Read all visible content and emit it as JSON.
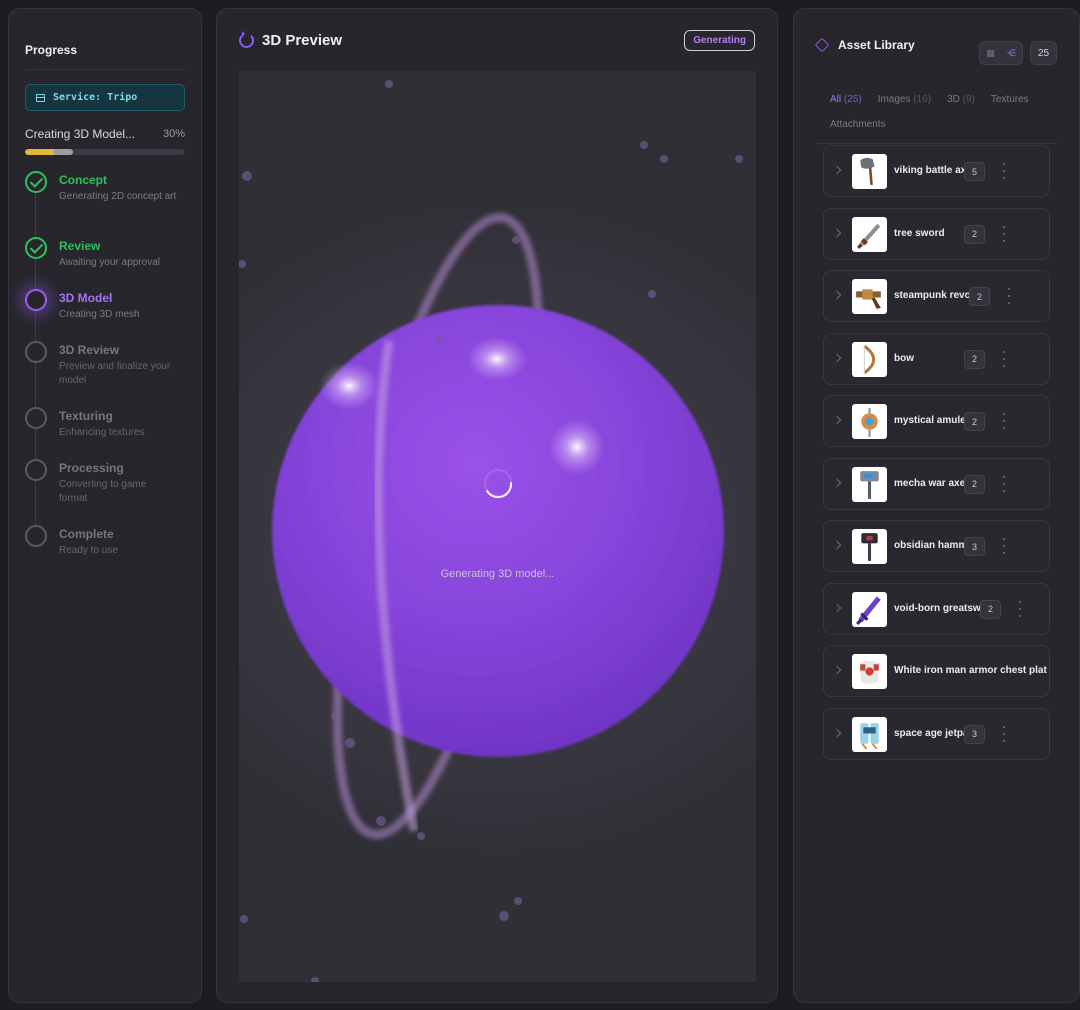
{
  "progress": {
    "title": "Progress",
    "service_label": "Service: Tripo",
    "status_text": "Creating 3D Model...",
    "percent_label": "30%",
    "percent_value": 30,
    "steps": [
      {
        "label": "Concept",
        "desc": "Generating 2D concept art",
        "state": "done"
      },
      {
        "label": "Review",
        "desc": "Awaiting your approval",
        "state": "done"
      },
      {
        "label": "3D Model",
        "desc": "Creating 3D mesh",
        "state": "active"
      },
      {
        "label": "3D Review",
        "desc": "Preview and finalize your model",
        "state": "pending"
      },
      {
        "label": "Texturing",
        "desc": "Enhancing textures",
        "state": "pending"
      },
      {
        "label": "Processing",
        "desc": "Converting to game format",
        "state": "pending"
      },
      {
        "label": "Complete",
        "desc": "Ready to use",
        "state": "pending"
      }
    ]
  },
  "preview": {
    "title": "3D Preview",
    "badge": "Generating",
    "loading_text": "Generating 3D model..."
  },
  "library": {
    "title": "Asset Library",
    "count": "25",
    "tabs": [
      {
        "label": "All",
        "count": "(25)",
        "active": true
      },
      {
        "label": "Images",
        "count": "(16)",
        "active": false
      },
      {
        "label": "3D",
        "count": "(9)",
        "active": false
      },
      {
        "label": "Textures",
        "count": "",
        "active": false
      },
      {
        "label": "Attachments",
        "count": "",
        "active": false
      }
    ],
    "items": [
      {
        "name": "viking battle axe",
        "count": "5",
        "icon": "axe-icon"
      },
      {
        "name": "tree sword",
        "count": "2",
        "icon": "sword-icon"
      },
      {
        "name": "steampunk revolver",
        "count": "2",
        "icon": "revolver-icon"
      },
      {
        "name": "bow",
        "count": "2",
        "icon": "bow-icon"
      },
      {
        "name": "mystical amulet",
        "count": "2",
        "icon": "amulet-icon"
      },
      {
        "name": "mecha war axe",
        "count": "2",
        "icon": "mecha-axe-icon"
      },
      {
        "name": "obsidian hammer",
        "count": "3",
        "icon": "hammer-icon"
      },
      {
        "name": "void-born greatsword",
        "count": "2",
        "icon": "greatsword-icon"
      },
      {
        "name": "White iron man armor chest plat",
        "count": "",
        "icon": "armor-icon"
      },
      {
        "name": "space age jetpack",
        "count": "3",
        "icon": "jetpack-icon"
      }
    ]
  },
  "colors": {
    "accent": "#9b5cf5",
    "success": "#2fbf5f",
    "progress_bar": "#e2b93b"
  }
}
